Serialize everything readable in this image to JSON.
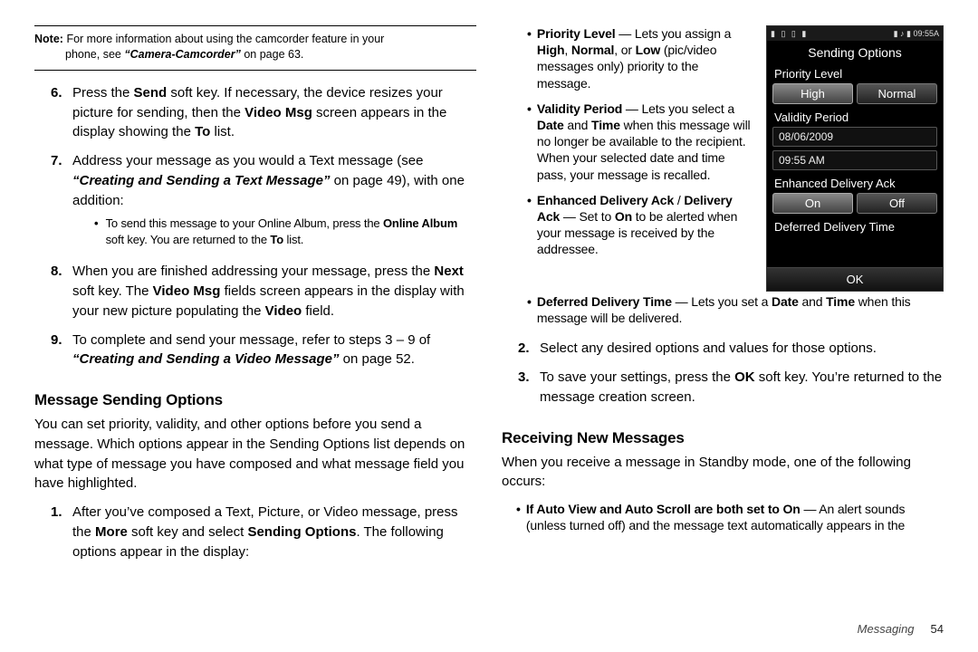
{
  "note": {
    "label": "Note:",
    "line1": "For more information about using the camcorder feature in your",
    "line2_pre": "phone, see ",
    "line2_ref": "“Camera-Camcorder”",
    "line2_post": " on page 63."
  },
  "left": {
    "step6": {
      "marker": "6.",
      "t1": "Press the ",
      "b1": "Send",
      "t2": " soft key. If necessary, the device resizes your picture for sending, then the ",
      "b2": "Video Msg",
      "t3": " screen appears in the display showing the ",
      "b3": "To",
      "t4": " list."
    },
    "step7": {
      "marker": "7.",
      "t1": "Address your message as you would a Text message (see ",
      "ref": "“Creating and Sending a Text Message”",
      "t2": " on page 49), with one addition:",
      "sub_t1": "To send this message to your Online Album, press the ",
      "sub_b1": "Online Album",
      "sub_t2": " soft key. You are returned to the ",
      "sub_b2": "To",
      "sub_t3": " list."
    },
    "step8": {
      "marker": "8.",
      "t1": "When you are finished addressing your message, press the ",
      "b1": "Next",
      "t2": " soft key. The ",
      "b2": "Video Msg",
      "t3": " fields screen appears in the display with your new picture populating the ",
      "b3": "Video",
      "t4": " field."
    },
    "step9": {
      "marker": "9.",
      "t1": "To complete and send your message, refer to steps 3 – 9 of ",
      "ref": "“Creating and Sending a Video Message”",
      "t2": " on page 52."
    },
    "sec1_head": "Message Sending Options",
    "sec1_para": "You can set priority, validity, and other options before you send a message. Which options appear in the Sending Options list depends on what type of message you have composed and what message field you have highlighted.",
    "sec1_step1": {
      "marker": "1.",
      "t1": "After you’ve composed a Text, Picture, or Video message, press the ",
      "b1": "More",
      "t2": " soft key and select ",
      "b2": "Sending Options",
      "t3": ". The following options appear in the display:"
    }
  },
  "right": {
    "bul1": {
      "b1": "Priority Level",
      "t1": " — Lets you assign a ",
      "b2": "High",
      "t2": ", ",
      "b3": "Normal",
      "t3": ", or ",
      "b4": "Low",
      "t4": " (pic/video messages only) priority to the message."
    },
    "bul2": {
      "b1": "Validity Period",
      "t1": " — Lets you select a ",
      "b2": "Date",
      "t2": " and ",
      "b3": "Time",
      "t3": " when this message will no longer be available to the recipient. When your selected date and time pass, your message is recalled."
    },
    "bul3": {
      "b1": "Enhanced Delivery Ack",
      "t1": " / ",
      "b2": "Delivery Ack",
      "t2": " — Set to ",
      "b3": "On",
      "t3": " to be alerted when your message is received by the addressee."
    },
    "bul4": {
      "b1": "Deferred Delivery Time",
      "t1": " — Lets you set a ",
      "b2": "Date",
      "t2": " and ",
      "b3": "Time",
      "t3": " when this message will be delivered."
    },
    "step2": {
      "marker": "2.",
      "t1": "Select any desired options and values for those options."
    },
    "step3": {
      "marker": "3.",
      "t1": "To save your settings, press the ",
      "b1": "OK",
      "t2": " soft key. You’re returned to the message creation screen."
    },
    "sec2_head": "Receiving New Messages",
    "sec2_para": "When you receive a message in Standby mode, one of the following occurs:",
    "sec2_bul": {
      "b1": "If Auto View and Auto Scroll are both set to On",
      "t1": " — An alert sounds (unless turned off) and the message text automatically appears in the"
    }
  },
  "phone": {
    "status_left": "▮ ▯ ▯ ▮",
    "status_right": "▮ ♪ ▮ 09:55A",
    "title": "Sending Options",
    "priority_label": "Priority Level",
    "priority_high": "High",
    "priority_normal": "Normal",
    "validity_label": "Validity Period",
    "validity_date": "08/06/2009",
    "validity_time": "09:55 AM",
    "eda_label": "Enhanced Delivery Ack",
    "eda_on": "On",
    "eda_off": "Off",
    "ddt_label": "Deferred Delivery Time",
    "ok": "OK"
  },
  "footer": {
    "section": "Messaging",
    "page": "54"
  }
}
